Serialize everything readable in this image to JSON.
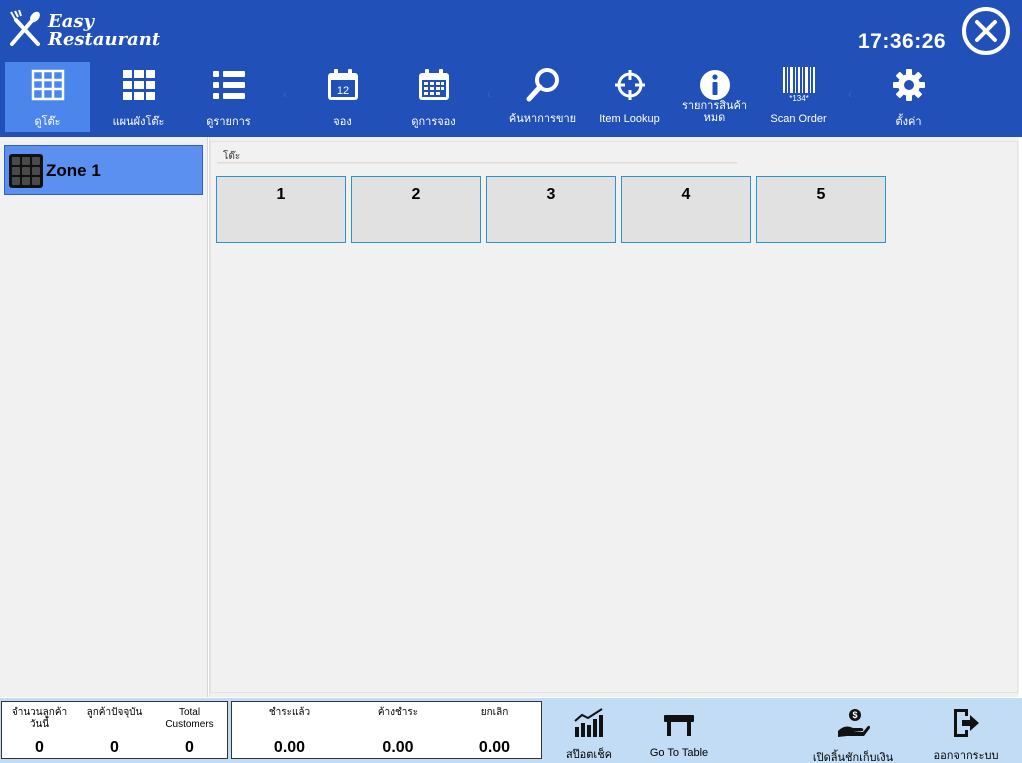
{
  "app": {
    "logo_line1": "Easy",
    "logo_line2": "Restaurant",
    "clock": "17:36:26"
  },
  "toolbar": [
    {
      "label": "ดูโต๊ะ",
      "icon": "grid-small-icon",
      "active": true
    },
    {
      "label": "แผนผังโต๊ะ",
      "icon": "grid-large-icon"
    },
    {
      "label": "ดูรายการ",
      "icon": "list-icon"
    },
    {
      "label": "จอง",
      "icon": "calendar-day-icon",
      "badge": "12"
    },
    {
      "label": "ดูการจอง",
      "icon": "calendar-month-icon"
    },
    {
      "label": "ค้นหาการขาย",
      "icon": "search-icon"
    },
    {
      "label": "Item Lookup",
      "icon": "crosshair-icon"
    },
    {
      "label": "รายการสินค้า\nหมด",
      "icon": "info-icon"
    },
    {
      "label": "Scan Order",
      "icon": "barcode-icon",
      "barcode_text": "*134*"
    },
    {
      "label": "ตั้งค่า",
      "icon": "gear-icon"
    }
  ],
  "zones": [
    {
      "label": "Zone 1"
    }
  ],
  "main": {
    "group_title": "โต๊ะ",
    "tables": [
      "1",
      "2",
      "3",
      "4",
      "5"
    ]
  },
  "stats_left": [
    {
      "label": "จำนวนลูกค้า\nวันนี้",
      "value": "0"
    },
    {
      "label": "ลูกค้าปัจจุบัน",
      "value": "0"
    },
    {
      "label": "Total\nCustomers",
      "value": "0"
    }
  ],
  "stats_right": [
    {
      "label": "ชำระแล้ว",
      "value": "0.00"
    },
    {
      "label": "ค้างชำระ",
      "value": "0.00"
    },
    {
      "label": "ยกเลิก",
      "value": "0.00"
    }
  ],
  "bottom_buttons": [
    {
      "label": "สป๊อตเช็ค",
      "icon": "chart-icon"
    },
    {
      "label": "Go To Table",
      "icon": "table-icon"
    },
    {
      "label": "เปิดลิ้นชักเก็บเงิน",
      "icon": "cash-hand-icon"
    },
    {
      "label": "ออกจากระบบ",
      "icon": "logout-icon"
    }
  ],
  "colors": {
    "header": "#2150b8",
    "active": "#4c86ec",
    "zone": "#5b90f0",
    "bottom": "#c2dcf6",
    "table_border": "#2a93d5"
  }
}
